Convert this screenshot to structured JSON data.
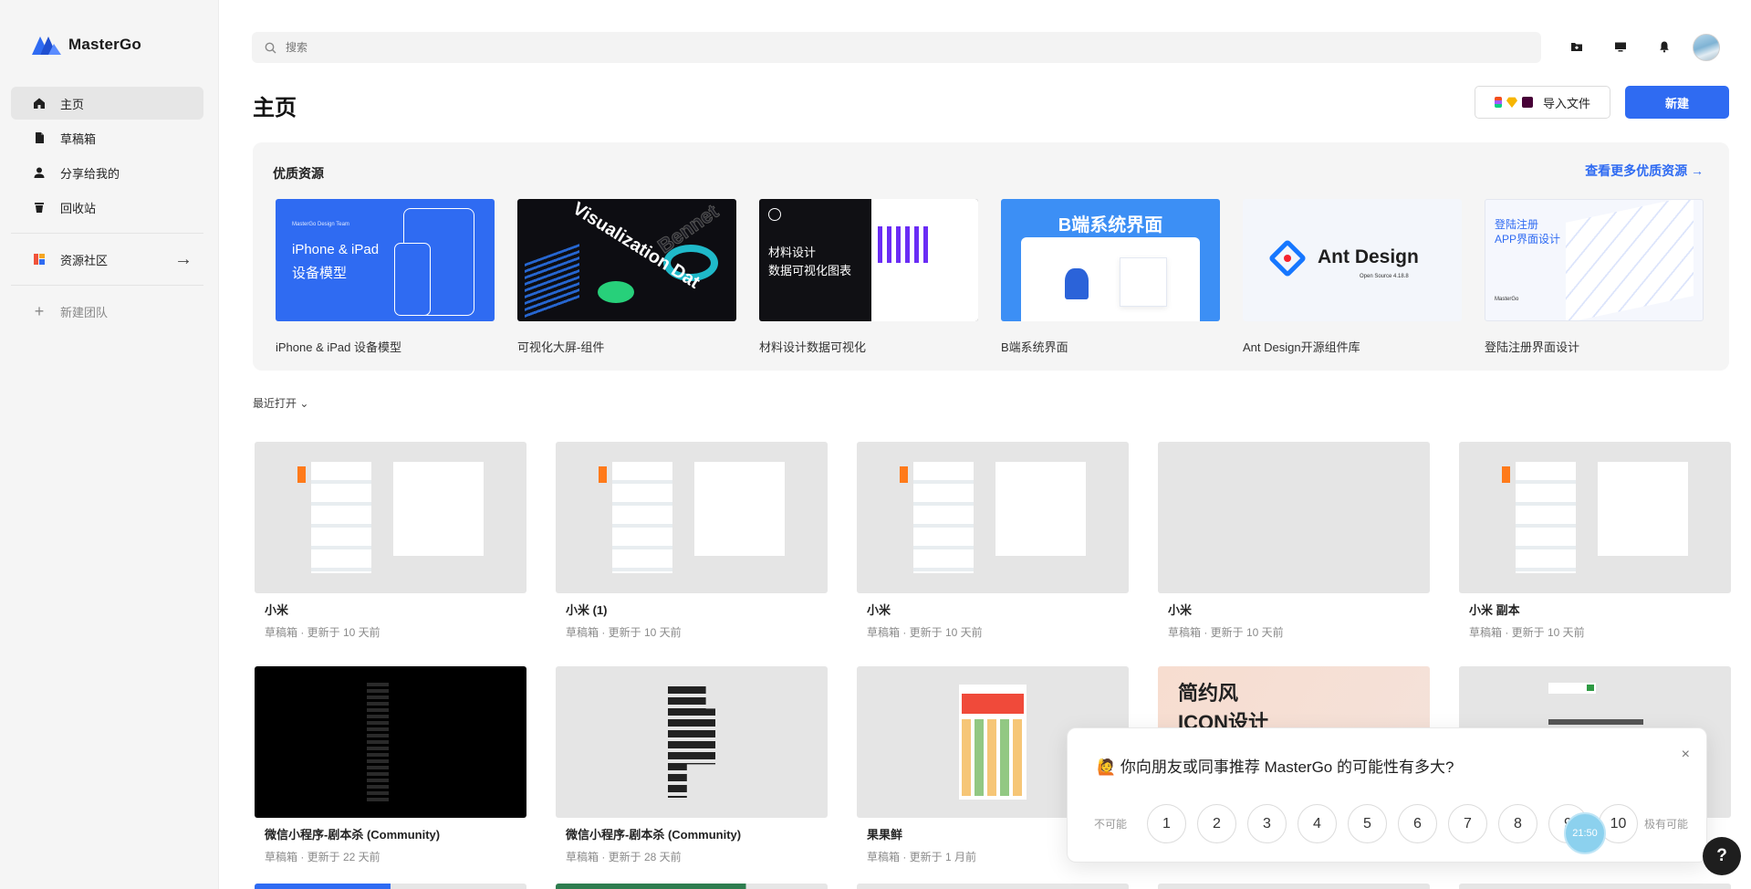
{
  "app": {
    "name": "MasterGo"
  },
  "sidebar": {
    "items": [
      {
        "label": "主页",
        "icon": "home-icon"
      },
      {
        "label": "草稿箱",
        "icon": "file-icon"
      },
      {
        "label": "分享给我的",
        "icon": "user-icon"
      },
      {
        "label": "回收站",
        "icon": "trash-icon"
      }
    ],
    "community": {
      "label": "资源社区",
      "arrow": "→"
    },
    "new_team": {
      "label": "新建团队",
      "plus": "+"
    }
  },
  "search": {
    "placeholder": "搜索"
  },
  "header": {
    "title": "主页",
    "import_label": "导入文件",
    "new_label": "新建"
  },
  "featured": {
    "title": "优质资源",
    "more_label": "查看更多优质资源 →",
    "items": [
      {
        "caption": "iPhone & iPad 设备模型",
        "thumb_brand": "MasterGo Design Team",
        "thumb_line1": "iPhone & iPad",
        "thumb_line2": "设备模型"
      },
      {
        "caption": "可视化大屏-组件",
        "thumb_text1": "Visualization Dat",
        "thumb_text2": "Bennet"
      },
      {
        "caption": "材料设计数据可视化",
        "thumb_line1": "材料设计",
        "thumb_line2": "数据可视化图表"
      },
      {
        "caption": "B端系统界面",
        "thumb_title": "B端系统界面"
      },
      {
        "caption": "Ant Design开源组件库",
        "thumb_title": "Ant Design",
        "thumb_sub": "Open Source 4.18.8"
      },
      {
        "caption": "登陆注册界面设计",
        "thumb_line1": "登陆注册",
        "thumb_line2": "APP界面设计",
        "thumb_brand": "MasterGo"
      }
    ]
  },
  "recent": {
    "label": "最近打开 ⌄"
  },
  "files": [
    {
      "name": "小米",
      "meta": "草稿箱 · 更新于 10 天前"
    },
    {
      "name": "小米 (1)",
      "meta": "草稿箱 · 更新于 10 天前"
    },
    {
      "name": "小米",
      "meta": "草稿箱 · 更新于 10 天前"
    },
    {
      "name": "小米",
      "meta": "草稿箱 · 更新于 10 天前"
    },
    {
      "name": "小米 副本",
      "meta": "草稿箱 · 更新于 10 天前"
    },
    {
      "name": "微信小程序-剧本杀 (Community)",
      "meta": "草稿箱 · 更新于 22 天前"
    },
    {
      "name": "微信小程序-剧本杀 (Community)",
      "meta": "草稿箱 · 更新于 28 天前"
    },
    {
      "name": "果果鲜",
      "meta": "草稿箱 · 更新于 1 月前"
    },
    {
      "name": "",
      "meta": "",
      "thumb_line1": "简约风",
      "thumb_line2": "ICON设计"
    },
    {
      "name": "",
      "meta": ""
    }
  ],
  "survey": {
    "emoji": "🙋",
    "question": "你向朋友或同事推荐 MasterGo 的可能性有多大?",
    "low_label": "不可能",
    "high_label": "极有可能",
    "scale": [
      "1",
      "2",
      "3",
      "4",
      "5",
      "6",
      "7",
      "8",
      "9",
      "10"
    ],
    "close": "×"
  },
  "timer": {
    "text": "21:50"
  },
  "help": {
    "label": "?"
  },
  "colors": {
    "accent": "#2f6bf2",
    "sidebar_bg": "#f5f5f5",
    "survey_timer": "#8cd1ee"
  }
}
